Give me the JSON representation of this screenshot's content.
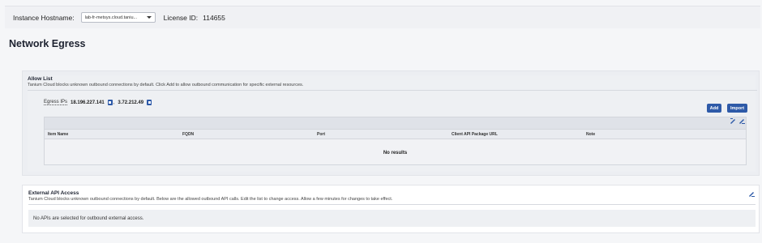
{
  "topbar": {
    "hostname_label": "Instance Hostname:",
    "hostname_value": "lab-fr-metsys.cloud.taniu...",
    "license_label": "License ID:",
    "license_value": "114655"
  },
  "page": {
    "title": "Network Egress"
  },
  "allow_list": {
    "title": "Allow List",
    "description": "Tanium Cloud blocks unknown outbound connections by default. Click Add to allow outbound communication for specific external resources.",
    "egress_label": "Egress IPs",
    "egress_ips": [
      "18.196.227.141",
      "3.72.212.49"
    ],
    "add_label": "Add",
    "import_label": "Import",
    "columns": [
      "Item Name",
      "FQDN",
      "Port",
      "Client API Package URL",
      "Note"
    ],
    "empty_text": "No results"
  },
  "external_api": {
    "title": "External API Access",
    "description": "Tanium Cloud blocks unknown outbound connections by default. Below are the allowed outbound API calls. Edit the list to change access. Allow a few minutes for changes to take effect.",
    "empty_text": "No APIs are selected for outbound external access."
  },
  "colors": {
    "accent": "#2e5aa8",
    "panel": "#eef0f3"
  },
  "icons": {
    "copy": "copy-icon",
    "edit": "pencil-icon",
    "columns": "column-edit-icon",
    "caret": "chevron-down-icon"
  }
}
